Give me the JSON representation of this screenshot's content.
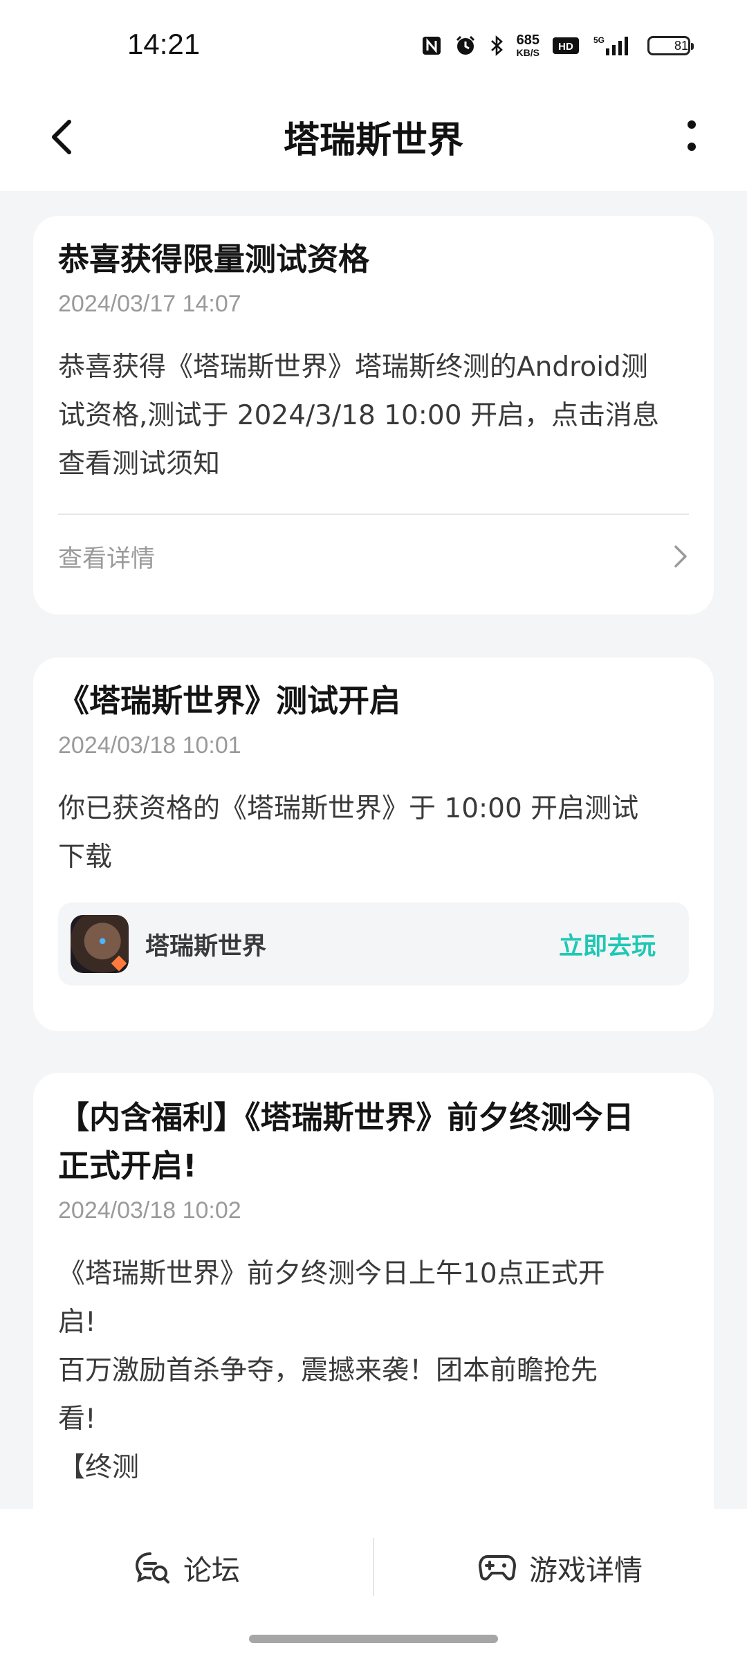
{
  "status_bar": {
    "time": "14:21",
    "net_speed_value": "685",
    "net_speed_unit": "KB/S",
    "battery": "81",
    "icons": [
      "nfc-icon",
      "alarm-icon",
      "bluetooth-icon",
      "hd-icon",
      "5g-signal-icon",
      "battery-icon"
    ]
  },
  "header": {
    "title": "塔瑞斯世界",
    "back_icon": "chevron-left-icon",
    "more_icon": "more-vertical-icon"
  },
  "messages": [
    {
      "title": "恭喜获得限量测试资格",
      "date": "2024/03/17 14:07",
      "body": "恭喜获得《塔瑞斯世界》塔瑞斯终测的Android测\n试资格,测试于 2024/3/18 10:00 开启，点击消息\n查看测试须知",
      "detail_link": "查看详情"
    },
    {
      "title": "《塔瑞斯世界》测试开启",
      "date": "2024/03/18 10:01",
      "body": "你已获资格的《塔瑞斯世界》于 10:00 开启测试\n下载",
      "game_name": "塔瑞斯世界",
      "play_label": "立即去玩"
    },
    {
      "title": "【内含福利】《塔瑞斯世界》前夕终测今日\n正式开启!",
      "date": "2024/03/18 10:02",
      "body": "《塔瑞斯世界》前夕终测今日上午10点正式开\n启!\n百万激励首杀争夺，震撼来袭！团本前瞻抢先\n看!\n【终测"
    }
  ],
  "bottom_nav": {
    "forum_label": "论坛",
    "forum_icon": "forum-chat-icon",
    "detail_label": "游戏详情",
    "detail_icon": "gamepad-icon"
  },
  "colors": {
    "accent": "#1ec8b4",
    "background": "#f4f5f7",
    "card": "#ffffff"
  }
}
